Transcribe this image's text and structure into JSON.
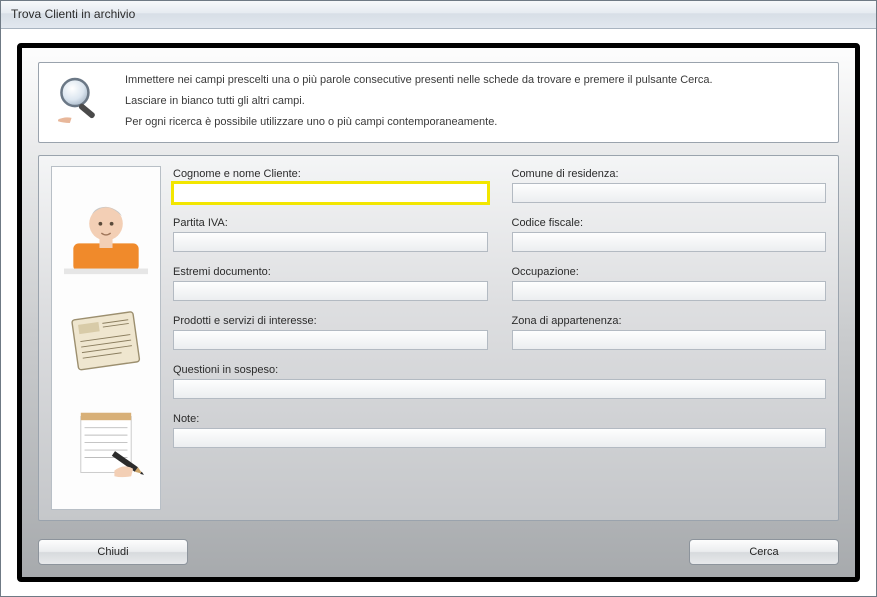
{
  "window": {
    "title": "Trova Clienti in archivio"
  },
  "info": {
    "line1": "Immettere nei campi prescelti una o più parole consecutive presenti nelle schede da trovare e premere il pulsante Cerca.",
    "line2": "Lasciare in bianco tutti gli altri campi.",
    "line3": "Per ogni ricerca è possibile utilizzare uno o più campi contemporaneamente."
  },
  "fields": {
    "cognome": {
      "label": "Cognome e nome Cliente:",
      "value": ""
    },
    "comune": {
      "label": "Comune di residenza:",
      "value": ""
    },
    "piva": {
      "label": "Partita IVA:",
      "value": ""
    },
    "cf": {
      "label": "Codice fiscale:",
      "value": ""
    },
    "estremi": {
      "label": "Estremi documento:",
      "value": ""
    },
    "occup": {
      "label": "Occupazione:",
      "value": ""
    },
    "prodotti": {
      "label": "Prodotti e servizi di interesse:",
      "value": ""
    },
    "zona": {
      "label": "Zona di appartenenza:",
      "value": ""
    },
    "questioni": {
      "label": "Questioni in sospeso:",
      "value": ""
    },
    "note": {
      "label": "Note:",
      "value": ""
    }
  },
  "buttons": {
    "close": "Chiudi",
    "search": "Cerca"
  },
  "icons": {
    "magnifier": "magnifier-icon",
    "person": "person-image",
    "document": "document-image",
    "notepad": "notepad-image"
  }
}
